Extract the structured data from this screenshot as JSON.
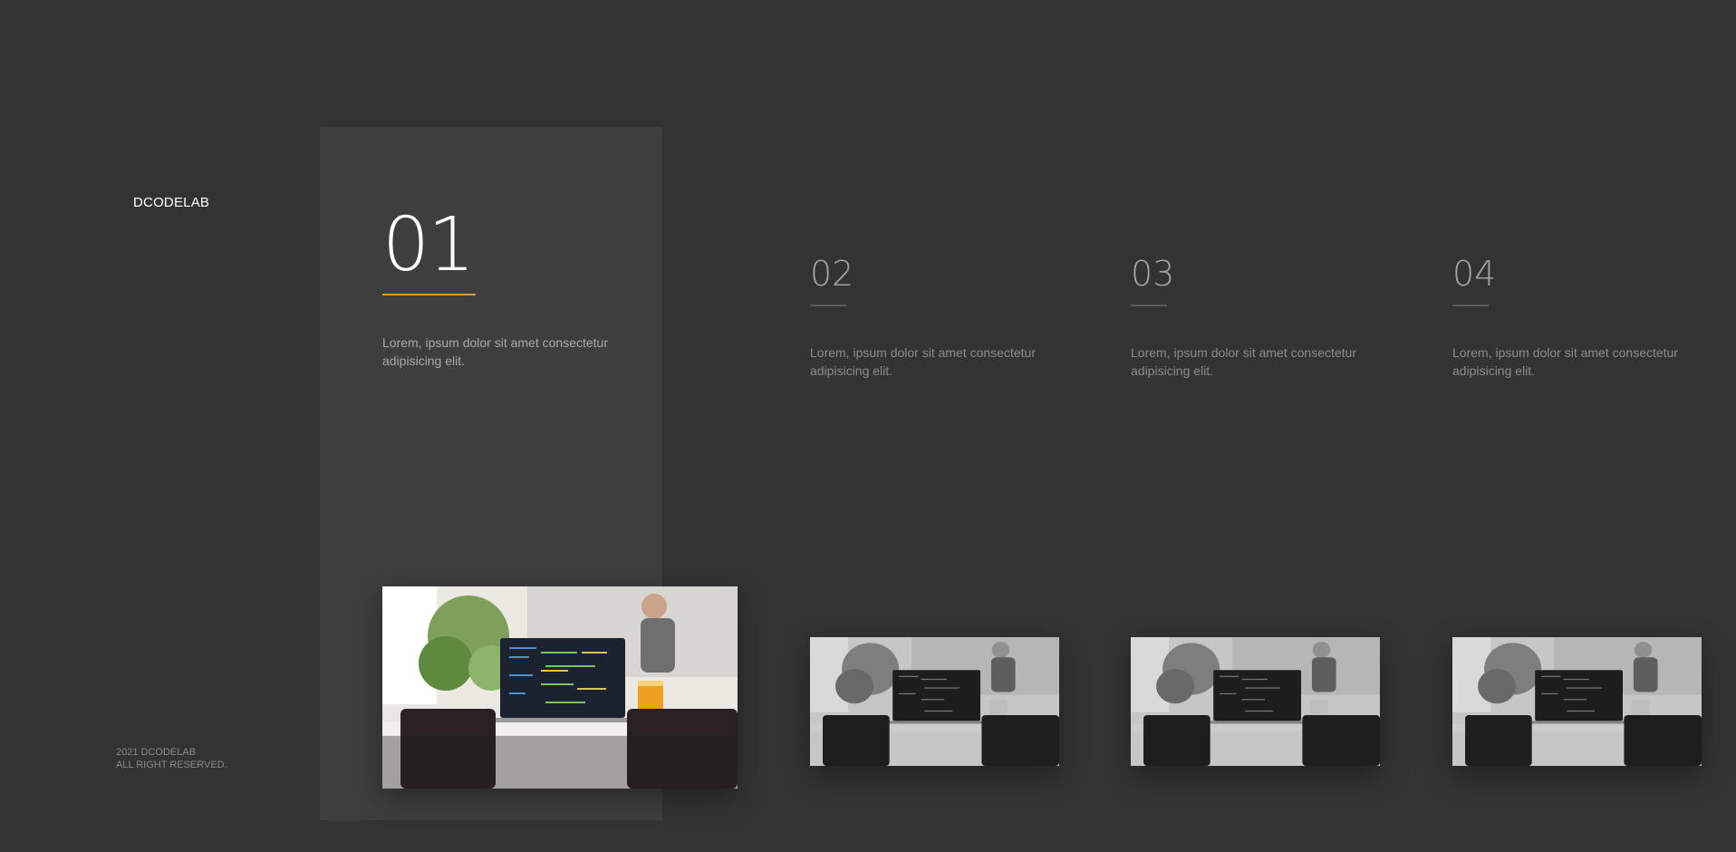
{
  "brand": {
    "logo": "DCODELAB"
  },
  "footer": {
    "line1": "2021 DCODELAB",
    "line2": "ALL RIGHT RESERVED."
  },
  "slides": [
    {
      "number": "01",
      "text": "Lorem, ipsum dolor sit amet consectetur adipisicing elit.",
      "active": true,
      "image": "laptop-cafe-photo"
    },
    {
      "number": "02",
      "text": "Lorem, ipsum dolor sit amet consectetur adipisicing elit.",
      "active": false,
      "image": "laptop-cafe-photo"
    },
    {
      "number": "03",
      "text": "Lorem, ipsum dolor sit amet consectetur adipisicing elit.",
      "active": false,
      "image": "laptop-cafe-photo"
    },
    {
      "number": "04",
      "text": "Lorem, ipsum dolor sit amet consectetur adipisicing elit.",
      "active": false,
      "image": "laptop-cafe-photo"
    }
  ],
  "colors": {
    "background": "#333333",
    "active_panel": "#3e3e3e",
    "accent": "#e0a030"
  }
}
